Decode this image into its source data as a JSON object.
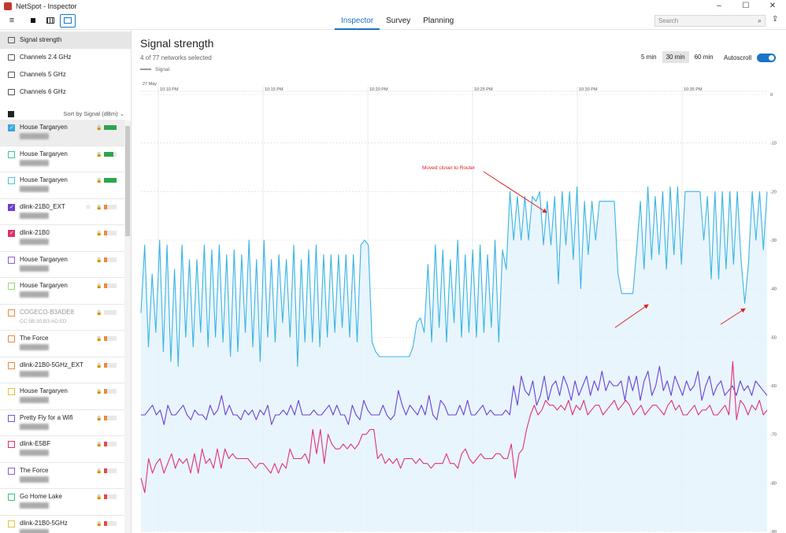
{
  "window": {
    "title": "NetSpot - Inspector",
    "controls": [
      "–",
      "☐",
      "✕"
    ]
  },
  "toolbar": {
    "tabs": [
      {
        "label": "Inspector",
        "selected": true
      },
      {
        "label": "Survey",
        "selected": false
      },
      {
        "label": "Planning",
        "selected": false
      }
    ],
    "search_placeholder": "Search"
  },
  "sidebar": {
    "views": [
      {
        "label": "Signal strength",
        "selected": true
      },
      {
        "label": "Channels 2.4 GHz"
      },
      {
        "label": "Channels 5 GHz"
      },
      {
        "label": "Channels 6 GHz"
      }
    ],
    "sort_label": "Sort by Signal (dBm)",
    "networks": [
      {
        "name": "House Targaryen",
        "color": "#3aa8e0",
        "checked": true,
        "locked": true,
        "signal_level": 4,
        "bar_color": "#2ea44f",
        "selected": true
      },
      {
        "name": "House Targaryen",
        "color": "#3fc2a0",
        "checked": false,
        "locked": true,
        "signal_level": 3,
        "bar_color": "#2ea44f"
      },
      {
        "name": "House Targaryen",
        "color": "#4fc3e0",
        "checked": false,
        "locked": true,
        "signal_level": 4,
        "bar_color": "#2ea44f"
      },
      {
        "name": "dlink-21B0_EXT",
        "color": "#6b3fd4",
        "checked": true,
        "locked": true,
        "pinned": true,
        "signal_level": 1,
        "bar_color": "#e88a3c"
      },
      {
        "name": "dlink-21B0",
        "color": "#e0306a",
        "checked": true,
        "locked": true,
        "signal_level": 1,
        "bar_color": "#e88a3c"
      },
      {
        "name": "House Targaryen",
        "color": "#8b5fd8",
        "checked": false,
        "locked": true,
        "signal_level": 1,
        "bar_color": "#e88a3c"
      },
      {
        "name": "House Targaryen",
        "color": "#9ed86a",
        "checked": false,
        "locked": true,
        "signal_level": 1,
        "bar_color": "#e88a3c"
      },
      {
        "name": "COGECO-B3ADE8",
        "color": "#e88a3c",
        "checked": false,
        "locked": true,
        "dim": true,
        "mac": "CC:5B:30:B3:AD:ED",
        "signal_level": 0,
        "bar_color": "#e88a3c"
      },
      {
        "name": "The Force",
        "color": "#e88a3c",
        "checked": false,
        "locked": true,
        "signal_level": 1,
        "bar_color": "#e88a3c"
      },
      {
        "name": "dlink-21B0-5GHz_EXT",
        "color": "#e88a3c",
        "checked": false,
        "locked": true,
        "signal_level": 1,
        "bar_color": "#e88a3c"
      },
      {
        "name": "House Targaryen",
        "color": "#e8c03c",
        "checked": false,
        "locked": true,
        "signal_level": 1,
        "bar_color": "#e88a3c"
      },
      {
        "name": "Pretty Fly for a Wifi",
        "color": "#6b5fd4",
        "checked": false,
        "locked": true,
        "signal_level": 1,
        "bar_color": "#e88a3c"
      },
      {
        "name": "dlink-E5BF",
        "color": "#e0306a",
        "checked": false,
        "locked": true,
        "signal_level": 1,
        "bar_color": "#e04a4a"
      },
      {
        "name": "The Force",
        "color": "#8b5fd8",
        "checked": false,
        "locked": true,
        "signal_level": 1,
        "bar_color": "#e04a4a"
      },
      {
        "name": "Go Home Lake",
        "color": "#3fc27a",
        "checked": false,
        "locked": true,
        "signal_level": 1,
        "bar_color": "#e04a4a"
      },
      {
        "name": "dlink-21B0-5GHz",
        "color": "#e8c03c",
        "checked": false,
        "locked": true,
        "signal_level": 1,
        "bar_color": "#e04a4a"
      }
    ]
  },
  "main": {
    "title": "Signal strength",
    "subtitle": "4 of 77 networks selected",
    "legend_label": "Signal",
    "ranges": [
      {
        "label": "5 min"
      },
      {
        "label": "30 min",
        "selected": true
      },
      {
        "label": "60 min"
      }
    ],
    "autoscroll_label": "Autoscroll",
    "autoscroll_on": true
  },
  "chart_data": {
    "type": "line",
    "date_label": "27 May",
    "x_ticks": [
      "10:10 PM",
      "10:15 PM",
      "10:20 PM",
      "10:25 PM",
      "10:30 PM",
      "10:35 PM"
    ],
    "y_ticks": [
      0,
      -10,
      -20,
      -30,
      -40,
      -50,
      -60,
      -70,
      -80,
      -90
    ],
    "ylim": [
      -90,
      0
    ],
    "y_unit": "dBm",
    "grid": true,
    "annotation": {
      "text": "Moved closer to Router",
      "color": "#e02020"
    },
    "series": [
      {
        "network": "House Targaryen",
        "color": "#38b4e6",
        "fill": true,
        "values": [
          -45,
          -31,
          -52,
          -37,
          -49,
          -30,
          -53,
          -31,
          -55,
          -36,
          -56,
          -31,
          -50,
          -34,
          -52,
          -34,
          -49,
          -31,
          -52,
          -32,
          -50,
          -31,
          -51,
          -33,
          -54,
          -32,
          -53,
          -33,
          -49,
          -30,
          -52,
          -34,
          -55,
          -30,
          -50,
          -34,
          -51,
          -33,
          -47,
          -34,
          -50,
          -31,
          -56,
          -34,
          -51,
          -32,
          -51,
          -31,
          -52,
          -33,
          -50,
          -33,
          -49,
          -33,
          -48,
          -33,
          -50,
          -33,
          -51,
          -31,
          -30,
          -31,
          -51,
          -53,
          -54,
          -54,
          -54,
          -54,
          -54,
          -54,
          -54,
          -54,
          -54,
          -52,
          -47,
          -46,
          -49,
          -35,
          -51,
          -31,
          -48,
          -32,
          -51,
          -34,
          -47,
          -30,
          -50,
          -33,
          -49,
          -32,
          -50,
          -31,
          -49,
          -33,
          -48,
          -30,
          -51,
          -32,
          -36,
          -20,
          -30,
          -21,
          -30,
          -21,
          -30,
          -21,
          -22,
          -20,
          -31,
          -22,
          -31,
          -21,
          -39,
          -20,
          -31,
          -20,
          -34,
          -19,
          -40,
          -22,
          -33,
          -22,
          -30,
          -22,
          -22,
          -22,
          -22,
          -22,
          -37,
          -41,
          -41,
          -41,
          -41,
          -32,
          -22,
          -36,
          -19,
          -34,
          -21,
          -33,
          -20,
          -36,
          -19,
          -33,
          -19,
          -35,
          -20,
          -20,
          -20,
          -20,
          -20,
          -30,
          -21,
          -38,
          -20,
          -38,
          -20,
          -36,
          -20,
          -35,
          -20,
          -34,
          -43,
          -35,
          -20,
          -30,
          -20,
          -32,
          -20
        ]
      },
      {
        "network": "dlink-21B0_EXT",
        "color": "#6a3fd8",
        "fill": false,
        "values": [
          -66,
          -66,
          -65,
          -64,
          -66,
          -65,
          -68,
          -64,
          -66,
          -66,
          -65,
          -64,
          -66,
          -67,
          -65,
          -66,
          -66,
          -67,
          -64,
          -66,
          -65,
          -62,
          -66,
          -64,
          -66,
          -66,
          -67,
          -65,
          -66,
          -65,
          -67,
          -65,
          -66,
          -64,
          -68,
          -66,
          -66,
          -65,
          -66,
          -64,
          -66,
          -63,
          -66,
          -66,
          -66,
          -65,
          -66,
          -66,
          -65,
          -64,
          -66,
          -64,
          -66,
          -66,
          -68,
          -64,
          -66,
          -67,
          -63,
          -65,
          -66,
          -66,
          -66,
          -64,
          -66,
          -67,
          -66,
          -61,
          -64,
          -66,
          -64,
          -65,
          -66,
          -64,
          -66,
          -62,
          -66,
          -67,
          -63,
          -64,
          -66,
          -66,
          -66,
          -64,
          -66,
          -63,
          -66,
          -66,
          -65,
          -64,
          -66,
          -65,
          -66,
          -66,
          -66,
          -65,
          -66,
          -60,
          -64,
          -58,
          -61,
          -62,
          -59,
          -64,
          -62,
          -58,
          -63,
          -60,
          -59,
          -62,
          -58,
          -60,
          -63,
          -59,
          -62,
          -60,
          -58,
          -62,
          -59,
          -61,
          -57,
          -61,
          -59,
          -60,
          -60,
          -59,
          -63,
          -58,
          -61,
          -58,
          -63,
          -59,
          -57,
          -62,
          -60,
          -56,
          -61,
          -59,
          -62,
          -58,
          -60,
          -62,
          -59,
          -61,
          -60,
          -57,
          -63,
          -60,
          -58,
          -62,
          -60,
          -59,
          -62,
          -61,
          -60,
          -62,
          -59,
          -61,
          -60,
          -62,
          -59,
          -60,
          -61,
          -62
        ]
      },
      {
        "network": "dlink-21B0",
        "color": "#e0307a",
        "fill": false,
        "values": [
          -79,
          -82,
          -75,
          -78,
          -76,
          -75,
          -78,
          -76,
          -74,
          -77,
          -75,
          -76,
          -75,
          -78,
          -74,
          -78,
          -73,
          -76,
          -75,
          -77,
          -73,
          -77,
          -73,
          -75,
          -74,
          -75,
          -75,
          -75,
          -75,
          -76,
          -77,
          -76,
          -76,
          -77,
          -78,
          -76,
          -78,
          -76,
          -77,
          -73,
          -75,
          -75,
          -75,
          -74,
          -76,
          -69,
          -74,
          -69,
          -76,
          -70,
          -72,
          -73,
          -73,
          -72,
          -73,
          -72,
          -73,
          -72,
          -70,
          -70,
          -69,
          -69,
          -75,
          -74,
          -76,
          -75,
          -76,
          -75,
          -77,
          -75,
          -75,
          -75,
          -76,
          -75,
          -76,
          -76,
          -77,
          -76,
          -76,
          -76,
          -74,
          -76,
          -76,
          -77,
          -74,
          -73,
          -75,
          -76,
          -75,
          -74,
          -75,
          -75,
          -75,
          -74,
          -74,
          -75,
          -75,
          -72,
          -79,
          -74,
          -73,
          -69,
          -66,
          -64,
          -66,
          -65,
          -63,
          -64,
          -64,
          -65,
          -64,
          -65,
          -63,
          -66,
          -64,
          -65,
          -63,
          -66,
          -65,
          -64,
          -64,
          -66,
          -65,
          -64,
          -63,
          -65,
          -64,
          -63,
          -64,
          -66,
          -65,
          -64,
          -66,
          -65,
          -64,
          -64,
          -65,
          -66,
          -64,
          -63,
          -65,
          -64,
          -66,
          -66,
          -65,
          -64,
          -66,
          -65,
          -65,
          -64,
          -66,
          -66,
          -65,
          -64,
          -66,
          -55,
          -67,
          -63,
          -64,
          -66,
          -64,
          -65,
          -63,
          -66,
          -65
        ]
      }
    ]
  }
}
